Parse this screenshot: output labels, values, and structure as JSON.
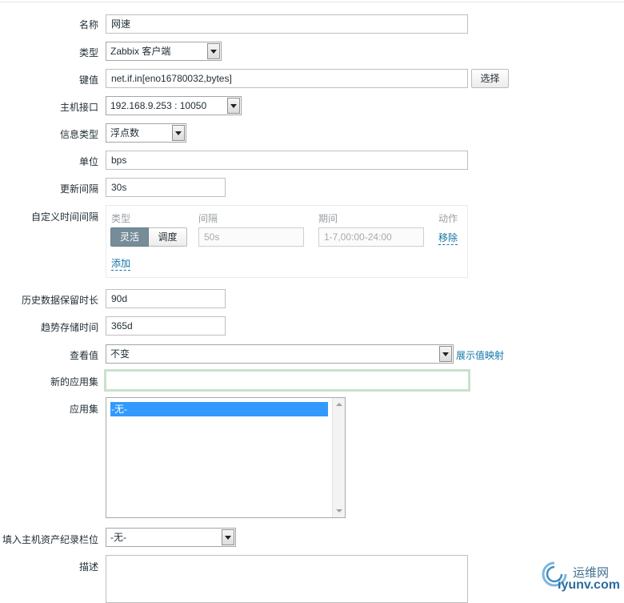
{
  "form": {
    "name": {
      "label": "名称",
      "value": "网速"
    },
    "type": {
      "label": "类型",
      "value": "Zabbix 客户端"
    },
    "key": {
      "label": "键值",
      "value": "net.if.in[eno16780032,bytes]",
      "button": "选择"
    },
    "interface": {
      "label": "主机接口",
      "value": "192.168.9.253 : 10050"
    },
    "info_type": {
      "label": "信息类型",
      "value": "浮点数"
    },
    "units": {
      "label": "单位",
      "value": "bps"
    },
    "update_interval": {
      "label": "更新间隔",
      "value": "30s"
    },
    "custom_intervals": {
      "label": "自定义时间间隔",
      "headers": {
        "type": "类型",
        "interval": "间隔",
        "period": "期间",
        "action": "动作"
      },
      "type_options": {
        "flexible": "灵活",
        "scheduling": "调度"
      },
      "interval_placeholder": "50s",
      "period_placeholder": "1-7,00:00-24:00",
      "remove": "移除",
      "add": "添加"
    },
    "history": {
      "label": "历史数据保留时长",
      "value": "90d"
    },
    "trends": {
      "label": "趋势存储时间",
      "value": "365d"
    },
    "show_value": {
      "label": "查看值",
      "value": "不变",
      "link": "展示值映射"
    },
    "new_application": {
      "label": "新的应用集",
      "value": ""
    },
    "applications": {
      "label": "应用集",
      "options": [
        "-无-"
      ]
    },
    "inventory": {
      "label": "填入主机资产纪录栏位",
      "value": "-无-"
    },
    "description": {
      "label": "描述",
      "value": ""
    }
  },
  "watermark": {
    "cn": "运维网",
    "en": "iyunv.com"
  },
  "colors": {
    "link": "#0e73a6",
    "selected": "#3399ff",
    "segment_active": "#768d99",
    "focus_border": "#c8e2cb"
  }
}
